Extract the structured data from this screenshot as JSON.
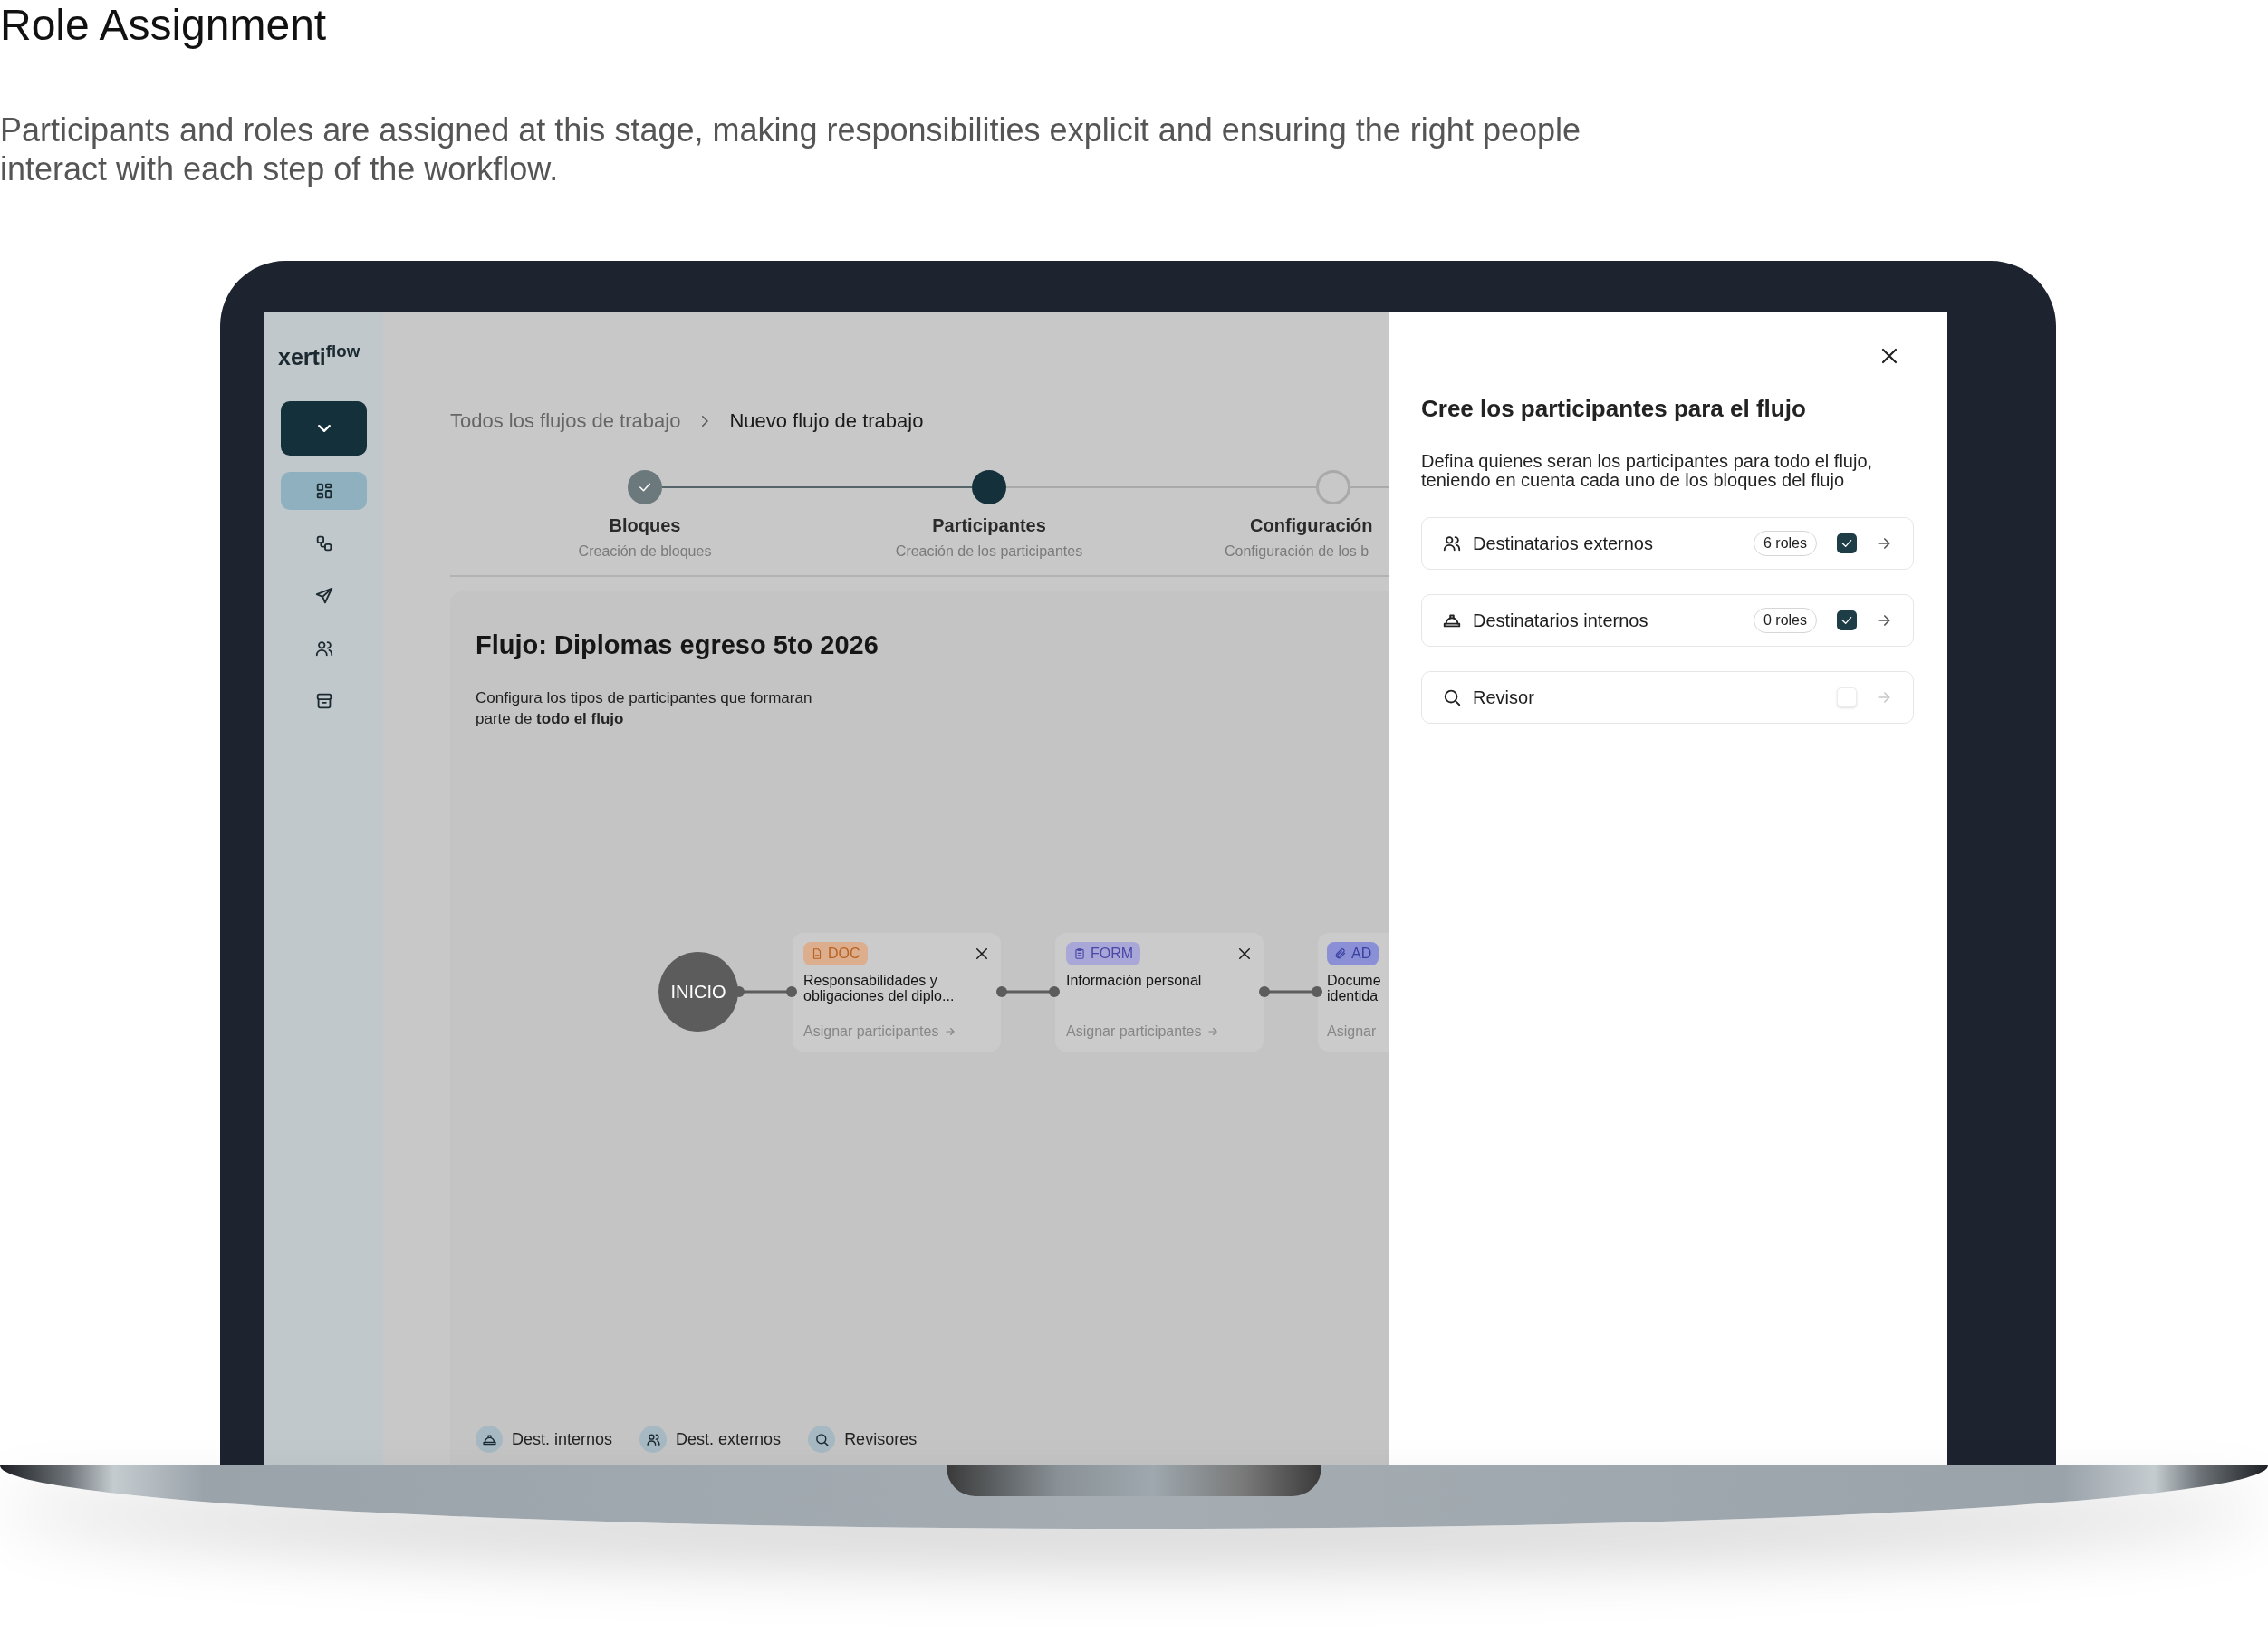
{
  "heading": "Role Assignment",
  "intro": "Participants and roles are assigned at this stage, making responsibilities explicit and ensuring the right people interact with each step of the workflow.",
  "app": {
    "logo": "xerti$^{flow}$",
    "sidebar": [
      {
        "kind": "blocks",
        "selected": true
      },
      {
        "kind": "flows",
        "selected": false
      },
      {
        "kind": "send",
        "selected": false
      },
      {
        "kind": "people",
        "selected": false
      },
      {
        "kind": "archive",
        "selected": false
      }
    ],
    "breadcrumb": [
      "Todos los flujos de trabajo",
      "Nuevo flujo de trabajo"
    ],
    "steps": [
      {
        "label": "Bloques",
        "sublabel": "Creación de bloques",
        "completed": true,
        "selected": false
      },
      {
        "label": "Participantes",
        "sublabel": "Creación de los participantes",
        "completed": false,
        "selected": true
      },
      {
        "label": "Configuración",
        "sublabel": "Configuración de los b",
        "completed": false,
        "selected": false
      }
    ],
    "flow": {
      "title": "Flujo: Diplomas egreso 5to 2026",
      "description": "Configura los tipos de participantes que formaran parte de **todo el flujo**",
      "start": "INICIO",
      "blocks": [
        {
          "kind": "doc",
          "tag": "DOC",
          "color": "#dcae8e",
          "title": "Responsabilidades y obligaciones del diplo...",
          "action": "Asignar participantes",
          "removable": true
        },
        {
          "kind": "form",
          "tag": "FORM",
          "color": "#a9a7d8",
          "title": "Información personal",
          "action": "Asignar participantes",
          "removable": true
        },
        {
          "kind": "attach",
          "tag": "AD",
          "color": "#8b8fd6",
          "title": "Docume identida",
          "action": "Asignar",
          "removable": false
        }
      ],
      "legend": [
        {
          "kind": "internal",
          "label": "Dest. internos"
        },
        {
          "kind": "external",
          "label": "Dest. externos"
        },
        {
          "kind": "reviewer",
          "label": "Revisores"
        }
      ]
    },
    "panel": {
      "title": "Cree los participantes para el flujo",
      "description": "Defina quienes seran los participantes para todo el flujo, teniendo en cuenta cada uno de los bloques del flujo",
      "rows": [
        {
          "kind": "external",
          "label": "Destinatarios externos",
          "count": "6 roles",
          "checked": true
        },
        {
          "kind": "internal",
          "label": "Destinatarios internos",
          "count": "0 roles",
          "checked": true
        },
        {
          "kind": "reviewer",
          "label": "Revisor",
          "checked": false
        }
      ]
    }
  }
}
